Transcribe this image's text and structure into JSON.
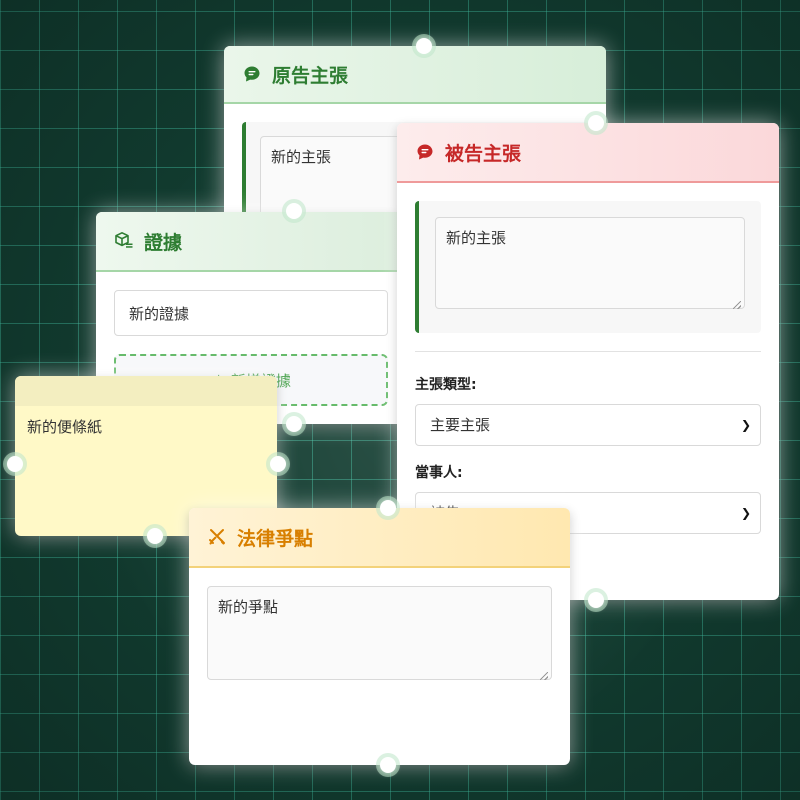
{
  "plaintiff": {
    "title": "原告主張",
    "content": "新的主張"
  },
  "evidence": {
    "title": "證據",
    "item_value": "新的證據",
    "add_label": "＋ 新增證據"
  },
  "defendant": {
    "title": "被告主張",
    "content": "新的主張",
    "claim_type_label": "主張類型:",
    "claim_type_value": "主要主張",
    "party_label": "當事人:",
    "party_value": "被告"
  },
  "sticky": {
    "content": "新的便條紙"
  },
  "issue": {
    "title": "法律爭點",
    "content": "新的爭點"
  },
  "colors": {
    "plaintiff_accent": "#2e7d32",
    "defendant_accent": "#c62828",
    "issue_accent": "#d87f00",
    "canvas_bg": "#123c30"
  }
}
